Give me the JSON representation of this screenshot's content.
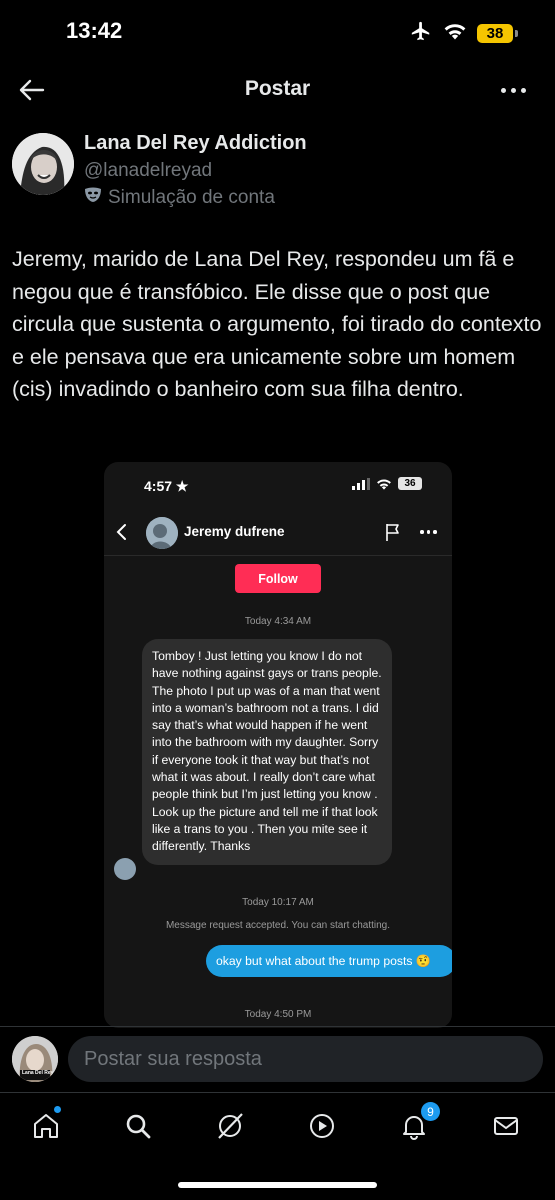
{
  "status_bar": {
    "time": "13:42",
    "battery": "38"
  },
  "header": {
    "title": "Postar"
  },
  "post": {
    "author_name": "Lana Del Rey Addiction",
    "author_handle": "@lanadelreyad",
    "account_label": "Simulação de conta",
    "text": "Jeremy, marido de Lana Del Rey, respondeu um fã e negou que é transfóbico. Ele disse que o post que circula que sustenta o argumento, foi tirado do contexto e ele pensava que era unicamente sobre um homem (cis) invadindo o banheiro com sua filha dentro."
  },
  "media": {
    "status_time": "4:57",
    "battery": "36",
    "contact_name": "Jeremy dufrene",
    "follow_label": "Follow",
    "timestamp_1": "Today 4:34 AM",
    "incoming_message": "Tomboy ! Just letting you know I do not have nothing against gays or trans people. The photo I put up was of a man that went into a woman’s bathroom not a trans. I did say that’s what would happen if he went into the bathroom with my daughter. Sorry if everyone took it that way but that’s not what it was about. I really don’t care what people think but I’m just letting you know . Look up the picture and tell me if that look like a trans to you . Then you mite see it differently. Thanks",
    "timestamp_2": "Today 10:17 AM",
    "system_message": "Message request accepted. You can start chatting.",
    "outgoing_message": "okay but what about the trump posts 🤨",
    "timestamp_3": "Today 4:50 PM"
  },
  "reply": {
    "placeholder": "Postar sua resposta",
    "avatar_text": "Lana Del Rey"
  },
  "nav": {
    "notification_count": "9",
    "icons": [
      "home-icon",
      "search-icon",
      "grok-icon",
      "video-icon",
      "bell-icon",
      "mail-icon"
    ]
  },
  "colors": {
    "accent": "#1d9bf0",
    "follow": "#ff2d55",
    "battery": "#f5c500"
  }
}
